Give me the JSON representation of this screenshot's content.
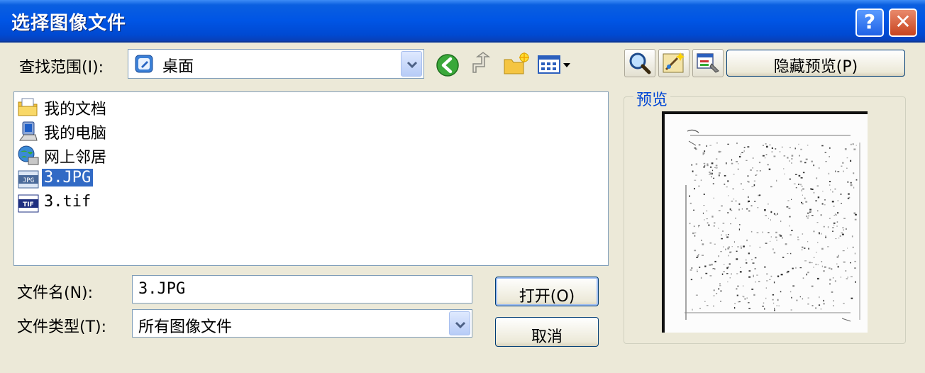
{
  "window": {
    "title": "选择图像文件",
    "help_glyph": "?",
    "close_glyph": "✕"
  },
  "lookin": {
    "label": "查找范围(I):",
    "value": "桌面"
  },
  "toolbar": {
    "icons": [
      "back-icon",
      "up-folder-icon",
      "new-folder-icon",
      "view-menu-icon"
    ]
  },
  "preview_toolbar": {
    "icons": [
      "zoom-icon",
      "wizard-icon",
      "properties-icon"
    ],
    "hide_preview_label": "隐藏预览(P)"
  },
  "files": [
    {
      "name": "我的文档",
      "icon": "my-documents-icon"
    },
    {
      "name": "我的电脑",
      "icon": "my-computer-icon"
    },
    {
      "name": "网上邻居",
      "icon": "network-places-icon"
    },
    {
      "name": "3.JPG",
      "icon": "jpg-file-icon",
      "selected": true
    },
    {
      "name": "3.tif",
      "icon": "tif-file-icon"
    }
  ],
  "filename": {
    "label": "文件名(N):",
    "value": "3.JPG"
  },
  "filetype": {
    "label": "文件类型(T):",
    "value": "所有图像文件"
  },
  "buttons": {
    "open": "打开(O)",
    "cancel": "取消"
  },
  "preview": {
    "title": "预览",
    "image_icon": "scanned-document-preview"
  },
  "colors": {
    "titlebar": "#0055e5",
    "dialog_bg": "#ece9d8",
    "selection": "#316ac5",
    "preview_title": "#0046d5"
  }
}
